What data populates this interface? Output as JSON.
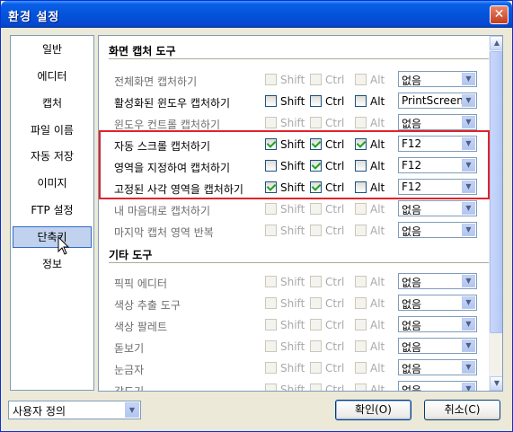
{
  "window": {
    "title": "환경 설정",
    "close_glyph": "✕"
  },
  "nav": {
    "items": [
      {
        "label": "일반",
        "selected": false
      },
      {
        "label": "에디터",
        "selected": false
      },
      {
        "label": "캡처",
        "selected": false
      },
      {
        "label": "파일 이름",
        "selected": false
      },
      {
        "label": "자동 저장",
        "selected": false
      },
      {
        "label": "이미지",
        "selected": false
      },
      {
        "label": "FTP 설정",
        "selected": false
      },
      {
        "label": "단축키",
        "selected": true
      },
      {
        "label": "정보",
        "selected": false
      }
    ]
  },
  "capture_section": {
    "title": "화면 캡처 도구",
    "rows": [
      {
        "label": "전체화면 캡처하기",
        "enabled": false,
        "shift": false,
        "ctrl": false,
        "alt": false,
        "key": "없음"
      },
      {
        "label": "활성화된 윈도우 캡처하기",
        "enabled": true,
        "shift": false,
        "ctrl": false,
        "alt": false,
        "key": "PrintScreen"
      },
      {
        "label": "윈도우 컨트롤 캡처하기",
        "enabled": false,
        "shift": false,
        "ctrl": false,
        "alt": false,
        "key": "없음"
      },
      {
        "label": "자동 스크롤 캡처하기",
        "enabled": true,
        "shift": true,
        "ctrl": true,
        "alt": true,
        "key": "F12"
      },
      {
        "label": "영역을 지정하여 캡처하기",
        "enabled": true,
        "shift": false,
        "ctrl": true,
        "alt": false,
        "key": "F12"
      },
      {
        "label": "고정된 사각 영역을 캡처하기",
        "enabled": true,
        "shift": true,
        "ctrl": true,
        "alt": false,
        "key": "F12"
      },
      {
        "label": "내 마음대로 캡처하기",
        "enabled": false,
        "shift": false,
        "ctrl": false,
        "alt": false,
        "key": "없음"
      },
      {
        "label": "마지막 캡처 영역 반복",
        "enabled": false,
        "shift": false,
        "ctrl": false,
        "alt": false,
        "key": "없음"
      }
    ]
  },
  "other_section": {
    "title": "기타 도구",
    "rows": [
      {
        "label": "픽픽 에디터",
        "enabled": false,
        "shift": false,
        "ctrl": false,
        "alt": false,
        "key": "없음"
      },
      {
        "label": "색상 추출 도구",
        "enabled": false,
        "shift": false,
        "ctrl": false,
        "alt": false,
        "key": "없음"
      },
      {
        "label": "색상 팔레트",
        "enabled": false,
        "shift": false,
        "ctrl": false,
        "alt": false,
        "key": "없음"
      },
      {
        "label": "돋보기",
        "enabled": false,
        "shift": false,
        "ctrl": false,
        "alt": false,
        "key": "없음"
      },
      {
        "label": "눈금자",
        "enabled": false,
        "shift": false,
        "ctrl": false,
        "alt": false,
        "key": "없음"
      },
      {
        "label": "각도기",
        "enabled": false,
        "shift": false,
        "ctrl": false,
        "alt": false,
        "key": "없음"
      }
    ]
  },
  "modifiers": {
    "shift": "Shift",
    "ctrl": "Ctrl",
    "alt": "Alt"
  },
  "footer": {
    "preset_value": "사용자 정의",
    "ok_label": "확인(O)",
    "cancel_label": "취소(C)"
  },
  "colors": {
    "highlight": "#e0232b",
    "accent": "#0553db"
  }
}
